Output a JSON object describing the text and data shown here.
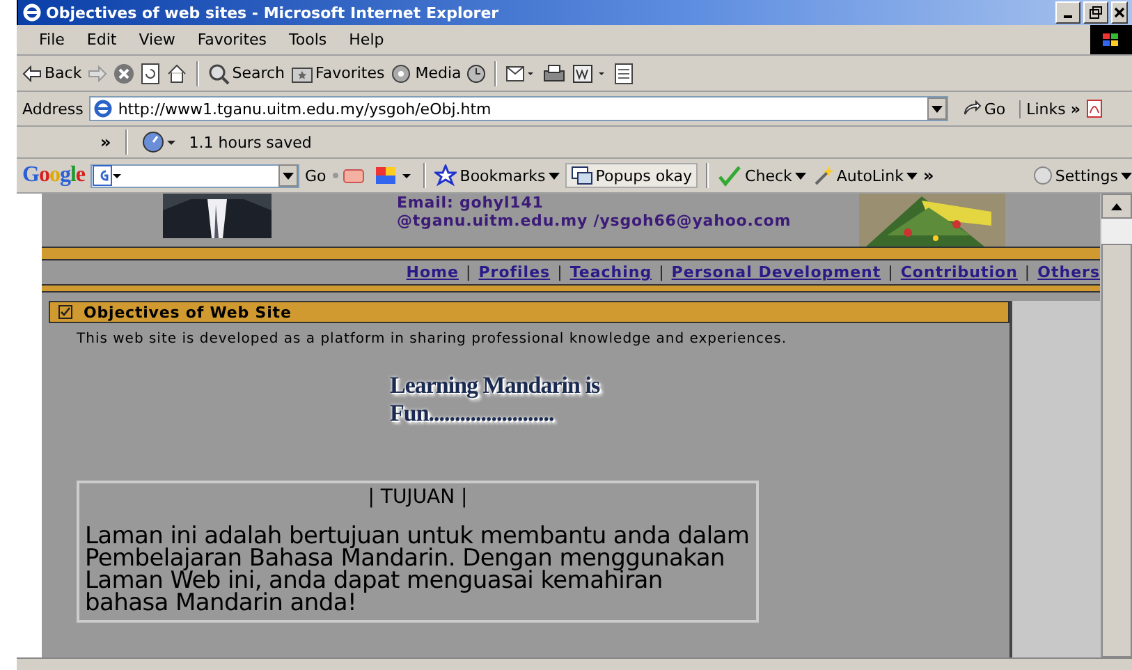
{
  "window": {
    "title": "Objectives of web sites - Microsoft Internet Explorer"
  },
  "menu": [
    "File",
    "Edit",
    "View",
    "Favorites",
    "Tools",
    "Help"
  ],
  "toolbar": [
    {
      "kind": "back",
      "label": "Back"
    },
    {
      "kind": "forward"
    },
    {
      "kind": "stop"
    },
    {
      "kind": "refresh"
    },
    {
      "kind": "home"
    },
    {
      "kind": "search",
      "label": "Search"
    },
    {
      "kind": "favorites",
      "label": "Favorites"
    },
    {
      "kind": "media",
      "label": "Media"
    },
    {
      "kind": "history"
    },
    {
      "kind": "mail"
    },
    {
      "kind": "print"
    },
    {
      "kind": "edit"
    },
    {
      "kind": "discuss"
    }
  ],
  "address": {
    "label": "Address",
    "value": "http://www1.tganu.uitm.edu.my/ysgoh/eObj.htm",
    "go": "Go",
    "links": "Links",
    "chevron": "»"
  },
  "links_bar": {
    "chevron": "»",
    "text": "1.1 hours saved"
  },
  "google_bar": {
    "logo": "Google",
    "go": "Go",
    "bookmarks": "Bookmarks",
    "popups": "Popups okay",
    "check": "Check",
    "autolink": "AutoLink",
    "chevron": "»",
    "settings": "Settings"
  },
  "page": {
    "email_lines": [
      "Email: gohyl141",
      "@tganu.uitm.edu.my /ysgoh66@yahoo.com"
    ],
    "nav": [
      {
        "label": "Home"
      },
      {
        "label": "Profiles",
        "sep": "|"
      },
      {
        "label": "Teaching",
        "sep": "|"
      },
      {
        "label": "Personal Development",
        "sep": "|"
      },
      {
        "label": "Contribution",
        "sep": "|"
      },
      {
        "label": "Others",
        "sep": "|"
      }
    ],
    "panel": {
      "title": "Objectives of Web Site",
      "checked": true,
      "intro": "This web site is developed as a platform in sharing professional knowledge and experiences.",
      "banner": "Learning Mandarin is Fun........................",
      "box_title": "| TUJUAN |",
      "box_text": "Laman ini adalah bertujuan untuk membantu anda dalam Pembelajaran Bahasa Mandarin. Dengan menggunakan Laman Web ini, anda dapat menguasai kemahiran bahasa Mandarin anda!"
    }
  }
}
